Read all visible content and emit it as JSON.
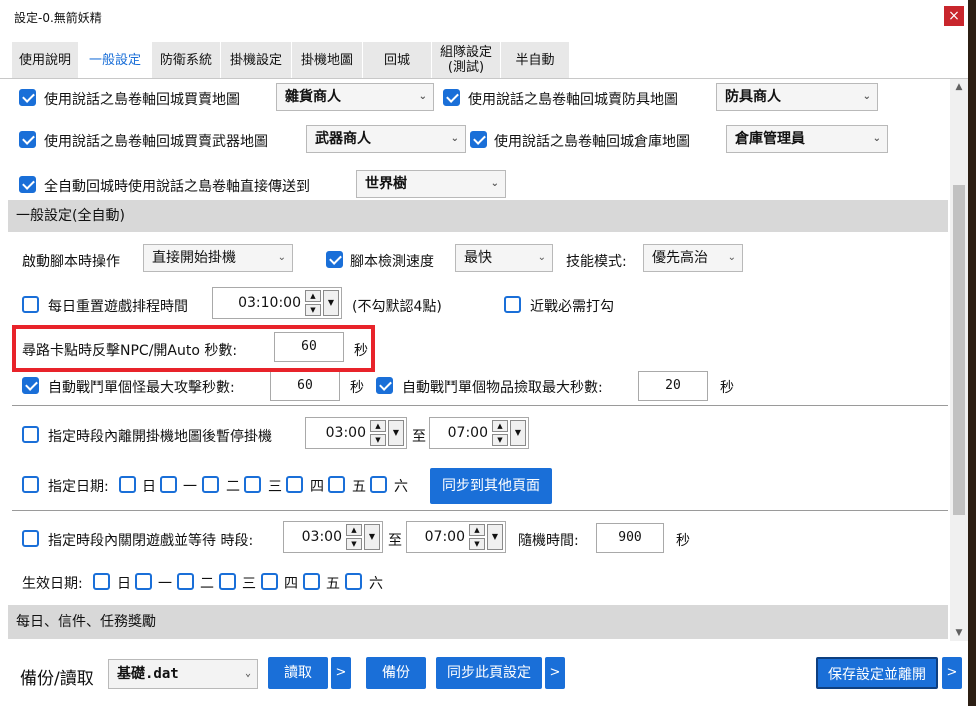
{
  "window": {
    "title": "設定-0.無箭妖精",
    "close_glyph": "×"
  },
  "tabs": [
    {
      "label": "使用說明"
    },
    {
      "label": "一般設定",
      "active": true
    },
    {
      "label": "防衛系統"
    },
    {
      "label": "掛機設定"
    },
    {
      "label": "掛機地圖"
    },
    {
      "label": "回城"
    },
    {
      "label": "組隊設定\n(測試)"
    },
    {
      "label": "半自動"
    }
  ],
  "town": {
    "row1": {
      "left_label": "使用說話之島卷軸回城買賣地圖",
      "left_value": "雜貨商人",
      "right_label": "使用說話之島卷軸回城賣防具地圖",
      "right_value": "防具商人"
    },
    "row2": {
      "left_label": "使用說話之島卷軸回城買賣武器地圖",
      "left_value": "武器商人",
      "right_label": "使用說話之島卷軸回城倉庫地圖",
      "right_value": "倉庫管理員"
    },
    "row3": {
      "label": "全自動回城時使用說話之島卷軸直接傳送到",
      "value": "世界樹"
    }
  },
  "general": {
    "section_title": "一般設定(全自動)",
    "start_label": "啟動腳本時操作",
    "start_value": "直接開始掛機",
    "detect_label": "腳本檢測速度",
    "detect_value": "最快",
    "skill_label": "技能模式:",
    "skill_value": "優先高治",
    "daily_reset_label": "每日重置遊戲排程時間",
    "daily_reset_time": "03:10:00",
    "daily_reset_note": "(不勾默認4點)",
    "melee_label": "近戰必需打勾",
    "stuck_label": "尋路卡點時反擊NPC/開Auto 秒數:",
    "stuck_value": "60",
    "stuck_unit": "秒",
    "monster_label": "自動戰鬥單個怪最大攻擊秒數:",
    "monster_value": "60",
    "monster_unit": "秒",
    "item_label": "自動戰鬥單個物品撿取最大秒數:",
    "item_value": "20",
    "item_unit": "秒",
    "pause_label": "指定時段內離開掛機地圖後暫停掛機",
    "pause_from": "03:00",
    "pause_to_label": "至",
    "pause_to": "07:00",
    "date_label": "指定日期:",
    "weekdays": [
      "日",
      "一",
      "二",
      "三",
      "四",
      "五",
      "六"
    ],
    "sync_button": "同步到其他頁面",
    "close_label": "指定時段內關閉遊戲並等待 時段:",
    "close_from": "03:00",
    "close_to_label": "至",
    "close_to": "07:00",
    "random_label": "隨機時間:",
    "random_value": "900",
    "random_unit": "秒",
    "effective_label": "生效日期:"
  },
  "daily_section_title": "每日、信件、任務獎勵",
  "bottom": {
    "backup_label": "備份/讀取",
    "file_value": "基礎.dat",
    "read_button": "讀取",
    "backup_button": "備份",
    "sync_button": "同步此頁設定",
    "save_button": "保存設定並離開",
    "more_glyph": ">"
  },
  "colors": {
    "accent": "#1a6fd8",
    "highlight_border": "#e8232a",
    "section_bg": "#d8d8d8"
  }
}
